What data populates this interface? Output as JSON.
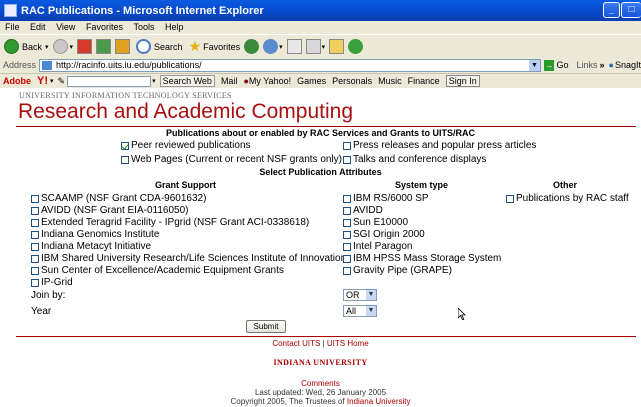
{
  "window": {
    "title": "RAC Publications - Microsoft Internet Explorer",
    "buttons": {
      "min": "_",
      "max": "□"
    }
  },
  "menu": [
    "File",
    "Edit",
    "View",
    "Favorites",
    "Tools",
    "Help"
  ],
  "toolbar": {
    "back": "Back",
    "search": "Search",
    "favorites": "Favorites"
  },
  "address": {
    "label": "Address",
    "url": "http://racinfo.uits.iu.edu/publications/",
    "go": "Go",
    "links": "Links",
    "snagit": "SnagIt"
  },
  "linksbar": {
    "adobe": "Adobe",
    "yahoo": "Y!",
    "search_web": "Search Web",
    "mail": "Mail",
    "my_yahoo": "My Yahoo!",
    "games": "Games",
    "personals": "Personals",
    "music": "Music",
    "finance": "Finance",
    "signin": "Sign In"
  },
  "page": {
    "uits": "University Information Technology Services",
    "title": "Research and Academic Computing",
    "pub_heading": "Publications about or enabled by RAC Services and Grants to UITS/RAC",
    "pub_types": [
      {
        "label": "Peer reviewed publications",
        "checked": true
      },
      {
        "label": "Press releases and popular press articles",
        "checked": false
      },
      {
        "label": "Web Pages (Current or recent NSF grants only)",
        "checked": false
      },
      {
        "label": "Talks and conference displays",
        "checked": false
      }
    ],
    "attr_heading": "Select Publication Attributes",
    "grant_heading": "Grant Support",
    "system_heading": "System type",
    "other_heading": "Other",
    "grants": [
      "SCAAMP (NSF Grant CDA-9601632)",
      "AVIDD (NSF Grant EIA-0116050)",
      "Extended Teragrid Facility - IPgrid (NSF Grant ACI-0338618)",
      "Indiana Genomics Institute",
      "Indiana Metacyt Initiative",
      "IBM Shared University Research/Life Sciences Institute of Innovation",
      "Sun Center of Excellence/Academic Equipment Grants",
      "IP-Grid"
    ],
    "systems": [
      "IBM RS/6000 SP",
      "AVIDD",
      "Sun E10000",
      "SGI Origin 2000",
      "Intel Paragon",
      "IBM HPSS Mass Storage System",
      "Gravity Pipe (GRAPE)"
    ],
    "other": [
      "Publications by RAC staff"
    ],
    "join_label": "Join by:",
    "join_value": "OR",
    "year_label": "Year",
    "year_value": "All",
    "submit": "Submit"
  },
  "footer": {
    "contact": "Contact UITS",
    "sep": " | ",
    "home": "UITS Home",
    "iu": "Indiana University",
    "comments": "Comments",
    "updated": "Last updated: Wed, 26 January 2005",
    "copyright_prefix": "Copyright 2005, The Trustees of ",
    "copyright_link": "Indiana University"
  },
  "colors": {
    "accent": "#a81010",
    "titlebar": "#0848c8"
  }
}
